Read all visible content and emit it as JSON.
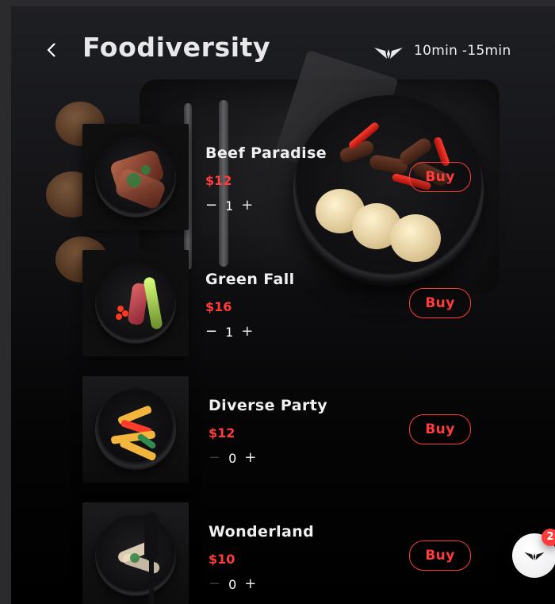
{
  "header": {
    "back_icon": "chevron-left-icon",
    "title": "Foodiversity",
    "logo_icon": "foodiversity-logo-icon",
    "eta": "10min -15min"
  },
  "menu": {
    "items": [
      {
        "name": "Beef Paradise",
        "price": "$12",
        "quantity": "1",
        "buy_label": "Buy"
      },
      {
        "name": "Green Fall",
        "price": "$16",
        "quantity": "1",
        "buy_label": "Buy"
      },
      {
        "name": "Diverse Party",
        "price": "$12",
        "quantity": "0",
        "buy_label": "Buy"
      },
      {
        "name": "Wonderland",
        "price": "$10",
        "quantity": "0",
        "buy_label": "Buy"
      }
    ],
    "quantity_controls": {
      "minus_icon": "minus-icon",
      "plus_icon": "plus-icon"
    }
  },
  "cart": {
    "icon": "foodiversity-logo-icon",
    "badge_count": "2"
  },
  "colors": {
    "accent": "#ff3b3b",
    "text": "#f0f0f2",
    "background": "#000000"
  }
}
